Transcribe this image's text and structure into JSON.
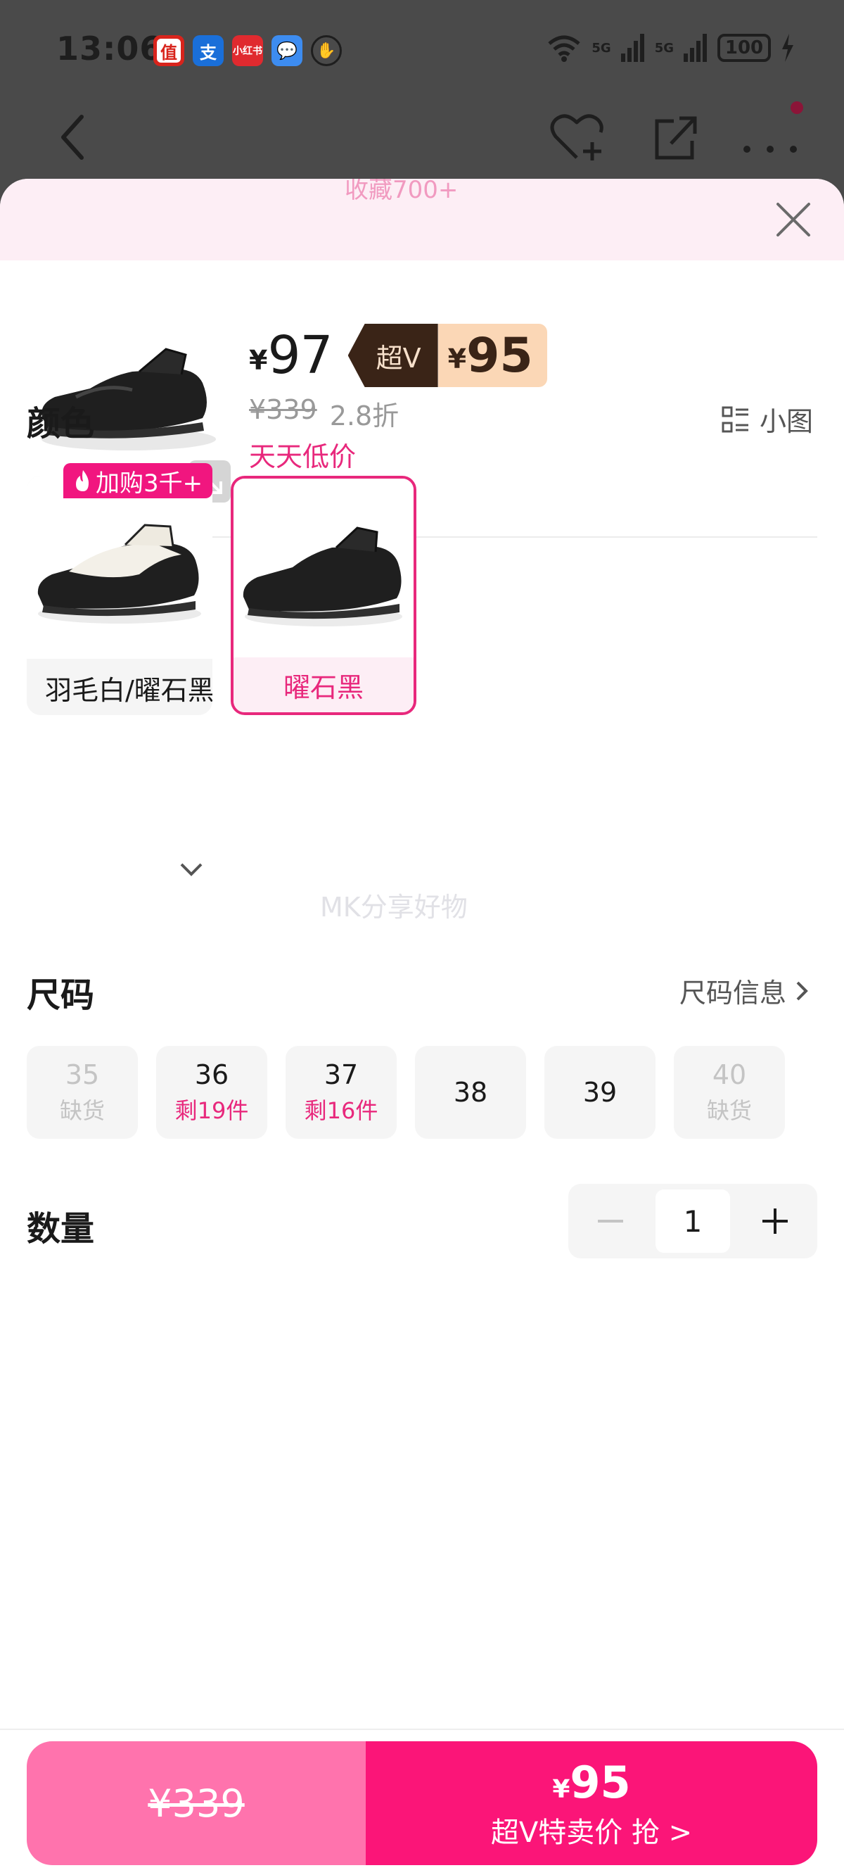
{
  "status_bar": {
    "time": "13:06",
    "apps": [
      "值",
      "支",
      "小红书",
      "💬",
      "✋"
    ],
    "signal_1": "5G",
    "signal_2": "5G",
    "battery": "100"
  },
  "sheet": {
    "collect_text": "收藏700+",
    "product": {
      "price_yen": "¥",
      "price": "97",
      "vip_label": "超V",
      "vip_yen": "¥",
      "vip_price": "95",
      "original_price": "¥339",
      "discount": "2.8折",
      "promo": "天天低价"
    },
    "color": {
      "title": "颜色",
      "view_toggle": "小图",
      "hot_badge": "加购3千+",
      "options": [
        {
          "label": "羽毛白/曜石黑",
          "selected": false
        },
        {
          "label": "曜石黑",
          "selected": true
        }
      ]
    },
    "watermark": "MK分享好物",
    "size": {
      "title": "尺码",
      "info_link": "尺码信息",
      "options": [
        {
          "num": "35",
          "stock": "缺货",
          "available": false
        },
        {
          "num": "36",
          "stock": "剩19件",
          "available": true
        },
        {
          "num": "37",
          "stock": "剩16件",
          "available": true
        },
        {
          "num": "38",
          "stock": "",
          "available": true
        },
        {
          "num": "39",
          "stock": "",
          "available": true
        },
        {
          "num": "40",
          "stock": "缺货",
          "available": false
        }
      ]
    },
    "quantity": {
      "title": "数量",
      "value": "1"
    }
  },
  "bottom": {
    "normal_price": "¥339",
    "vip_yen": "¥",
    "vip_price": "95",
    "vip_action": "超V特卖价 抢 >"
  },
  "colors": {
    "accent": "#e8287c",
    "buy_primary": "#fb1578",
    "buy_secondary": "#ff73ad",
    "vip_dark": "#3a2417",
    "vip_light": "#fbd7b6"
  }
}
